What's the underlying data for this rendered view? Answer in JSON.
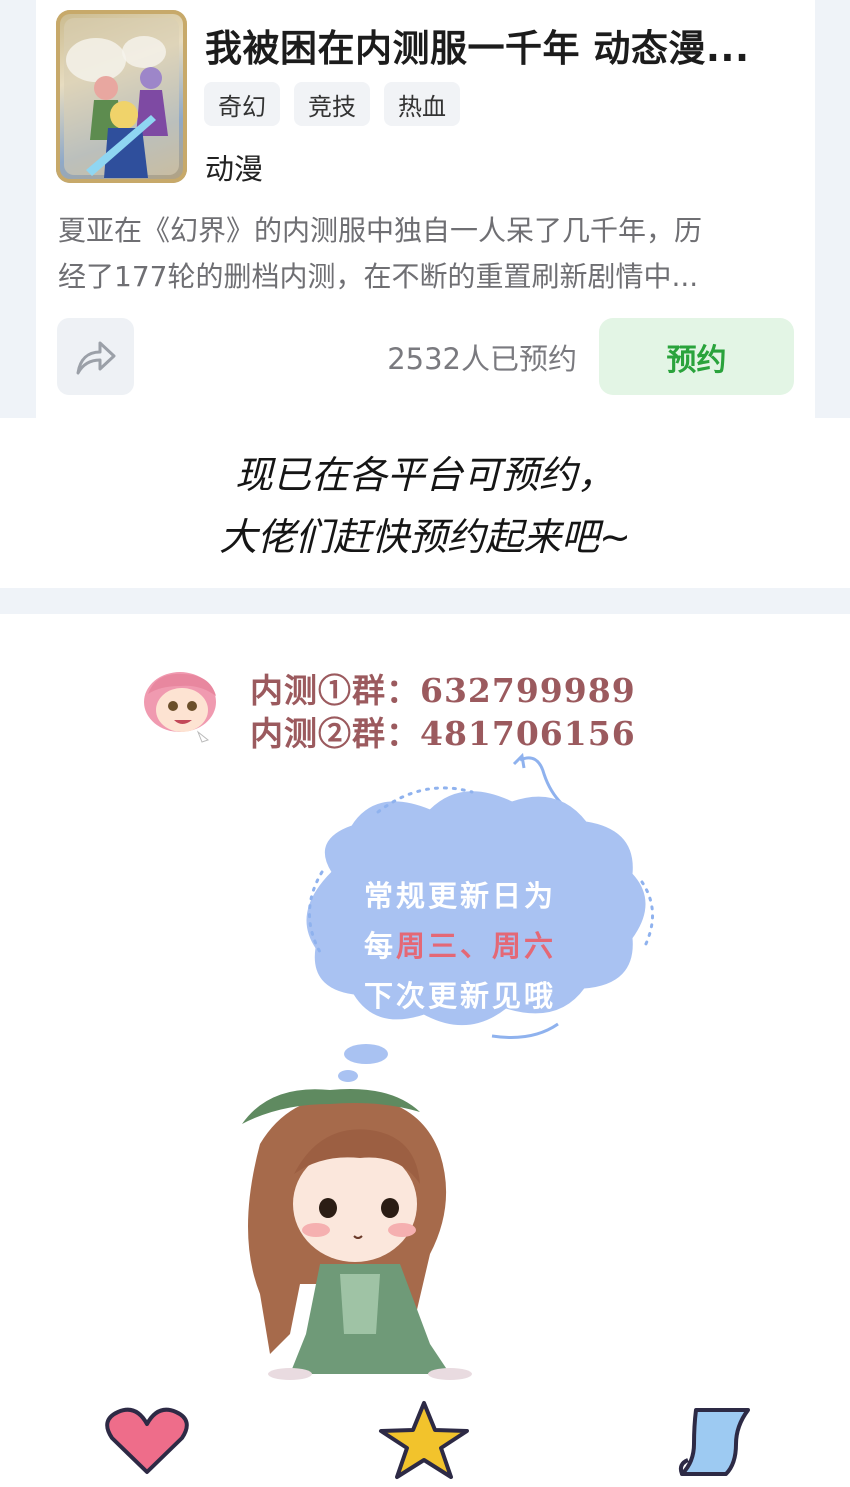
{
  "book": {
    "title": "我被困在内测服一千年 动态漫...",
    "tags": [
      "奇幻",
      "竞技",
      "热血"
    ],
    "category": "动漫",
    "description_lines": [
      "夏亚在《幻界》的内测服中独自一人呆了几千年，历",
      "经了177轮的删档内测，在不断的重置刷新剧情中..."
    ],
    "reservation_count": "2532人已预约",
    "reserve_label": "预约"
  },
  "message": {
    "line1": "现已在各平台可预约，",
    "line2": "大佬们赶快预约起来吧~"
  },
  "groups": {
    "line1": "内测①群：632799989",
    "line2": "内测②群：481706156"
  },
  "cloud": {
    "line1": "常规更新日为",
    "line2_prefix": "每",
    "line2_highlight": "周三、周六",
    "line3": "下次更新见哦"
  },
  "colors": {
    "reserve_text": "#2aa33c",
    "reserve_bg": "#e3f5e5",
    "group_text": "#9b5a5e",
    "cloud_fill": "#a9c2f2",
    "cloud_highlight": "#e46876"
  },
  "icons": {
    "share": "share-arrow-icon",
    "like": "heart-icon",
    "favorite": "star-icon",
    "comment": "scroll-icon"
  }
}
